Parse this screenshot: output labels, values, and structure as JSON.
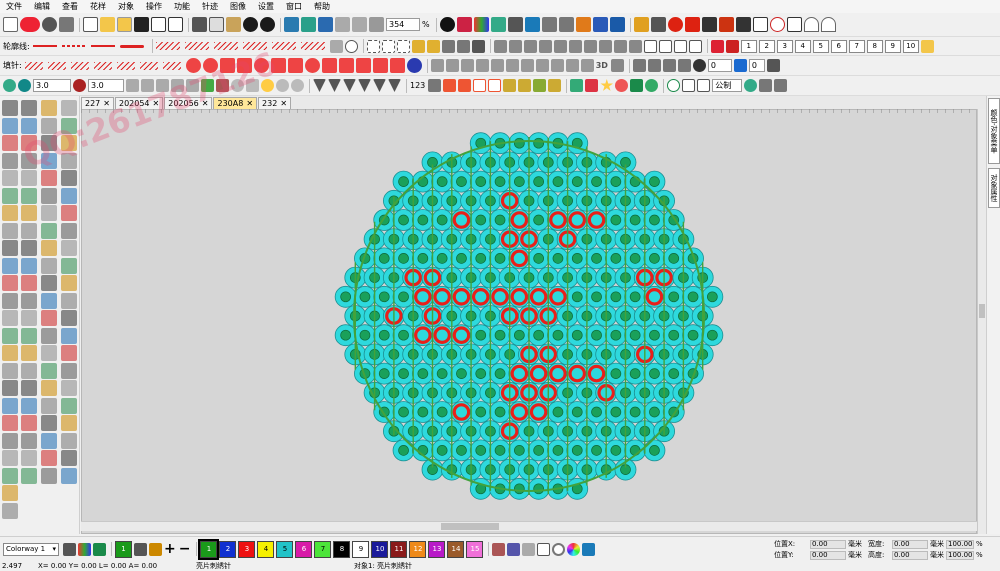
{
  "menu": [
    "文件",
    "编辑",
    "查看",
    "花样",
    "对象",
    "操作",
    "功能",
    "针迹",
    "图像",
    "设置",
    "窗口",
    "帮助"
  ],
  "toolbar1": {
    "zoom_value": "354",
    "zoom_unit": "%",
    "stop_label": "STOP",
    "fx_label": "fx"
  },
  "toolbar2": {
    "outline_label": "轮廓线:",
    "numbered_buttons": [
      "1",
      "2",
      "3",
      "4",
      "5",
      "6",
      "7",
      "8",
      "9",
      "10"
    ]
  },
  "toolbar3": {
    "fill_label": "填针:",
    "label_3d": "3D",
    "spin_value_1": "0",
    "spin_value_2": "0"
  },
  "toolbar4": {
    "width_value_1": "3.0",
    "width_value_2": "3.0",
    "seq_label": "123",
    "mode_select": "公制"
  },
  "document_tabs": [
    "227",
    "202054",
    "202056",
    "230A8",
    "232"
  ],
  "active_tab": "230A8",
  "side_tabs": [
    "颜色-对象菜单",
    "对象属性"
  ],
  "watermark": "QQ:261787126",
  "colorbar": {
    "colorway_label": "Colorway 1",
    "swatches": [
      {
        "num": "1",
        "color": "#1a9a1a",
        "selected": true
      },
      {
        "num": "2",
        "color": "#1030d0"
      },
      {
        "num": "3",
        "color": "#ee1111"
      },
      {
        "num": "4",
        "color": "#f6f000"
      },
      {
        "num": "5",
        "color": "#22c3c8"
      },
      {
        "num": "6",
        "color": "#d81aa8"
      },
      {
        "num": "7",
        "color": "#4ce43a"
      },
      {
        "num": "8",
        "color": "#000000"
      },
      {
        "num": "9",
        "color": "#ffffff"
      },
      {
        "num": "10",
        "color": "#1a1a9a"
      },
      {
        "num": "11",
        "color": "#8a1a1a"
      },
      {
        "num": "12",
        "color": "#ee8a1a"
      },
      {
        "num": "13",
        "color": "#b81ac8"
      },
      {
        "num": "14",
        "color": "#9a5a2a"
      },
      {
        "num": "15",
        "color": "#f070d8"
      }
    ]
  },
  "position_panel": {
    "pos_x_label": "位置X:",
    "pos_y_label": "位置Y:",
    "pos_x_value": "0.00",
    "pos_y_value": "0.00",
    "unit": "毫米",
    "width_label": "宽度:",
    "height_label": "高度:",
    "width_value": "0.00",
    "height_value": "0.00",
    "width_pct": "100.00",
    "height_pct": "100.00",
    "pct_unit": "%"
  },
  "status": {
    "coord": "2.497",
    "xy": "X=   0.00 Y=   0.00 L=   0.00 A=   0.00",
    "tool": "亮片刺绣针",
    "object": "对象1:  亮片刺绣针"
  },
  "design": {
    "sequin_color": "#2ed9dd",
    "hole_fill": "#1aa05a",
    "accent_color": "#e8201a",
    "thread_color": "#43a23c"
  }
}
